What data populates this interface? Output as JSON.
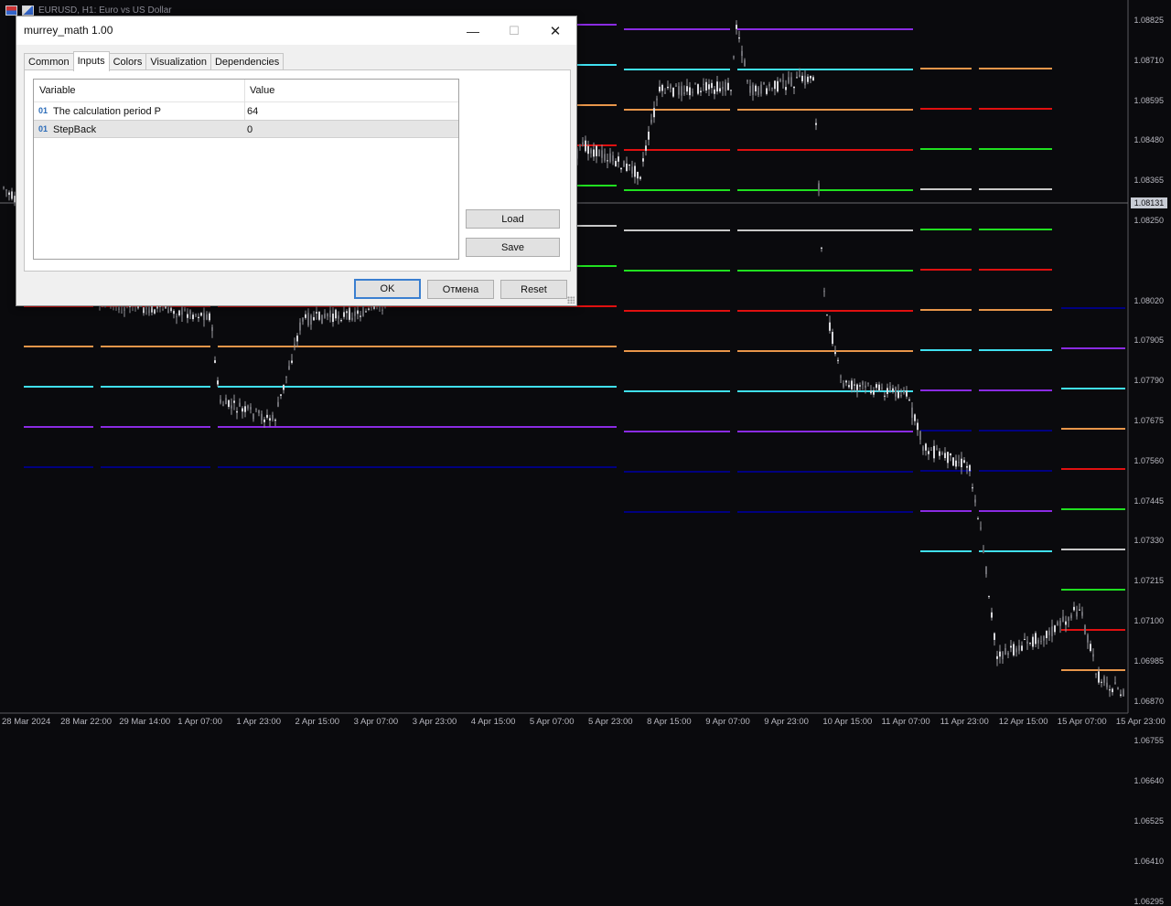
{
  "chart": {
    "title": "EURUSD, H1:  Euro vs US Dollar",
    "price_labels": [
      "1.08825",
      "1.08710",
      "1.08595",
      "1.08480",
      "1.08365",
      "1.08250",
      "1.08020",
      "1.07905",
      "1.07790",
      "1.07675",
      "1.07560",
      "1.07445",
      "1.07330",
      "1.07215",
      "1.07100",
      "1.06985",
      "1.06870",
      "1.06755",
      "1.06640",
      "1.06525",
      "1.06410",
      "1.06295"
    ],
    "current_price": "1.08131",
    "time_labels": [
      "28 Mar 2024",
      "28 Mar 22:00",
      "29 Mar 14:00",
      "1 Apr 07:00",
      "1 Apr 23:00",
      "2 Apr 15:00",
      "3 Apr 07:00",
      "3 Apr 23:00",
      "4 Apr 15:00",
      "5 Apr 07:00",
      "5 Apr 23:00",
      "8 Apr 15:00",
      "9 Apr 07:00",
      "9 Apr 23:00",
      "10 Apr 15:00",
      "11 Apr 07:00",
      "11 Apr 23:00",
      "12 Apr 15:00",
      "15 Apr 07:00",
      "15 Apr 23:00"
    ],
    "level_colors": {
      "navy": "#000080",
      "purple": "#8a2be2",
      "cyan": "#40e0f0",
      "orange": "#e8964a",
      "red": "#e01010",
      "green": "#20e020",
      "white": "#c8c8c8"
    }
  },
  "dialog": {
    "title": "murrey_math 1.00",
    "minimize": "—",
    "maximize": "☐",
    "close": "✕",
    "tabs": [
      "Common",
      "Inputs",
      "Colors",
      "Visualization",
      "Dependencies"
    ],
    "active_tab": "Inputs",
    "grid": {
      "headers": {
        "variable": "Variable",
        "value": "Value"
      },
      "rows": [
        {
          "icon": "01",
          "variable": "The calculation period P",
          "value": "64"
        },
        {
          "icon": "01",
          "variable": "StepBack",
          "value": "0"
        }
      ]
    },
    "buttons": {
      "load": "Load",
      "save": "Save",
      "ok": "OK",
      "cancel": "Отмена",
      "reset": "Reset"
    }
  }
}
